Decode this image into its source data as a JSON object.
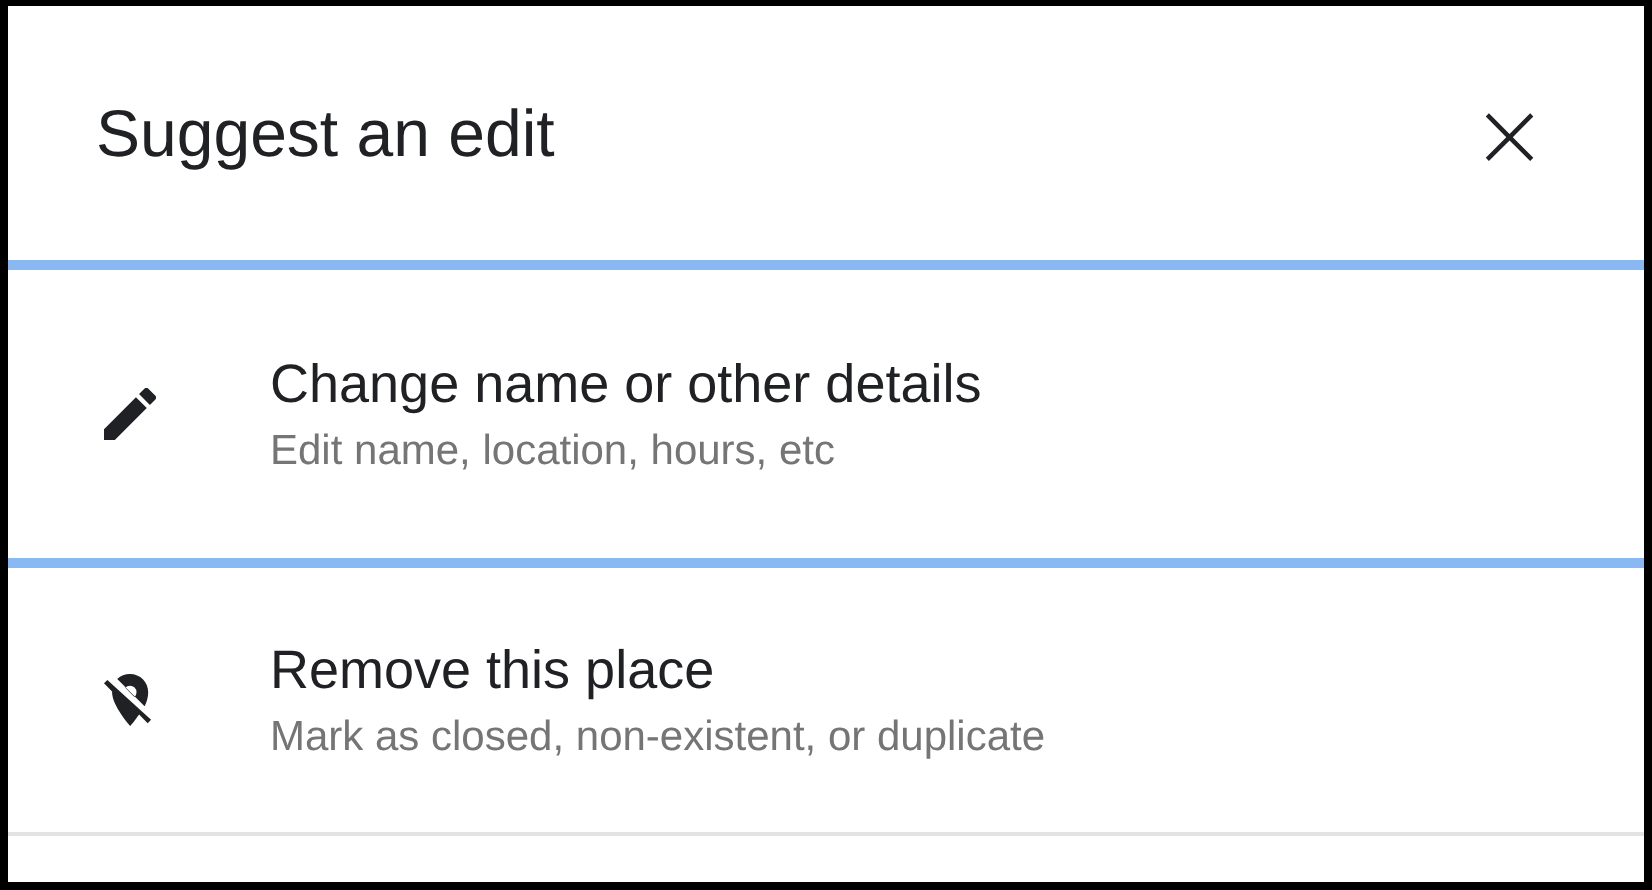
{
  "dialog": {
    "title": "Suggest an edit",
    "close": "×"
  },
  "options": [
    {
      "kind": "edit",
      "title": "Change name or other details",
      "subtitle": "Edit name, location, hours, etc",
      "selected": true
    },
    {
      "kind": "remove",
      "title": "Remove this place",
      "subtitle": "Mark as closed, non-existent, or duplicate",
      "selected": false
    }
  ]
}
